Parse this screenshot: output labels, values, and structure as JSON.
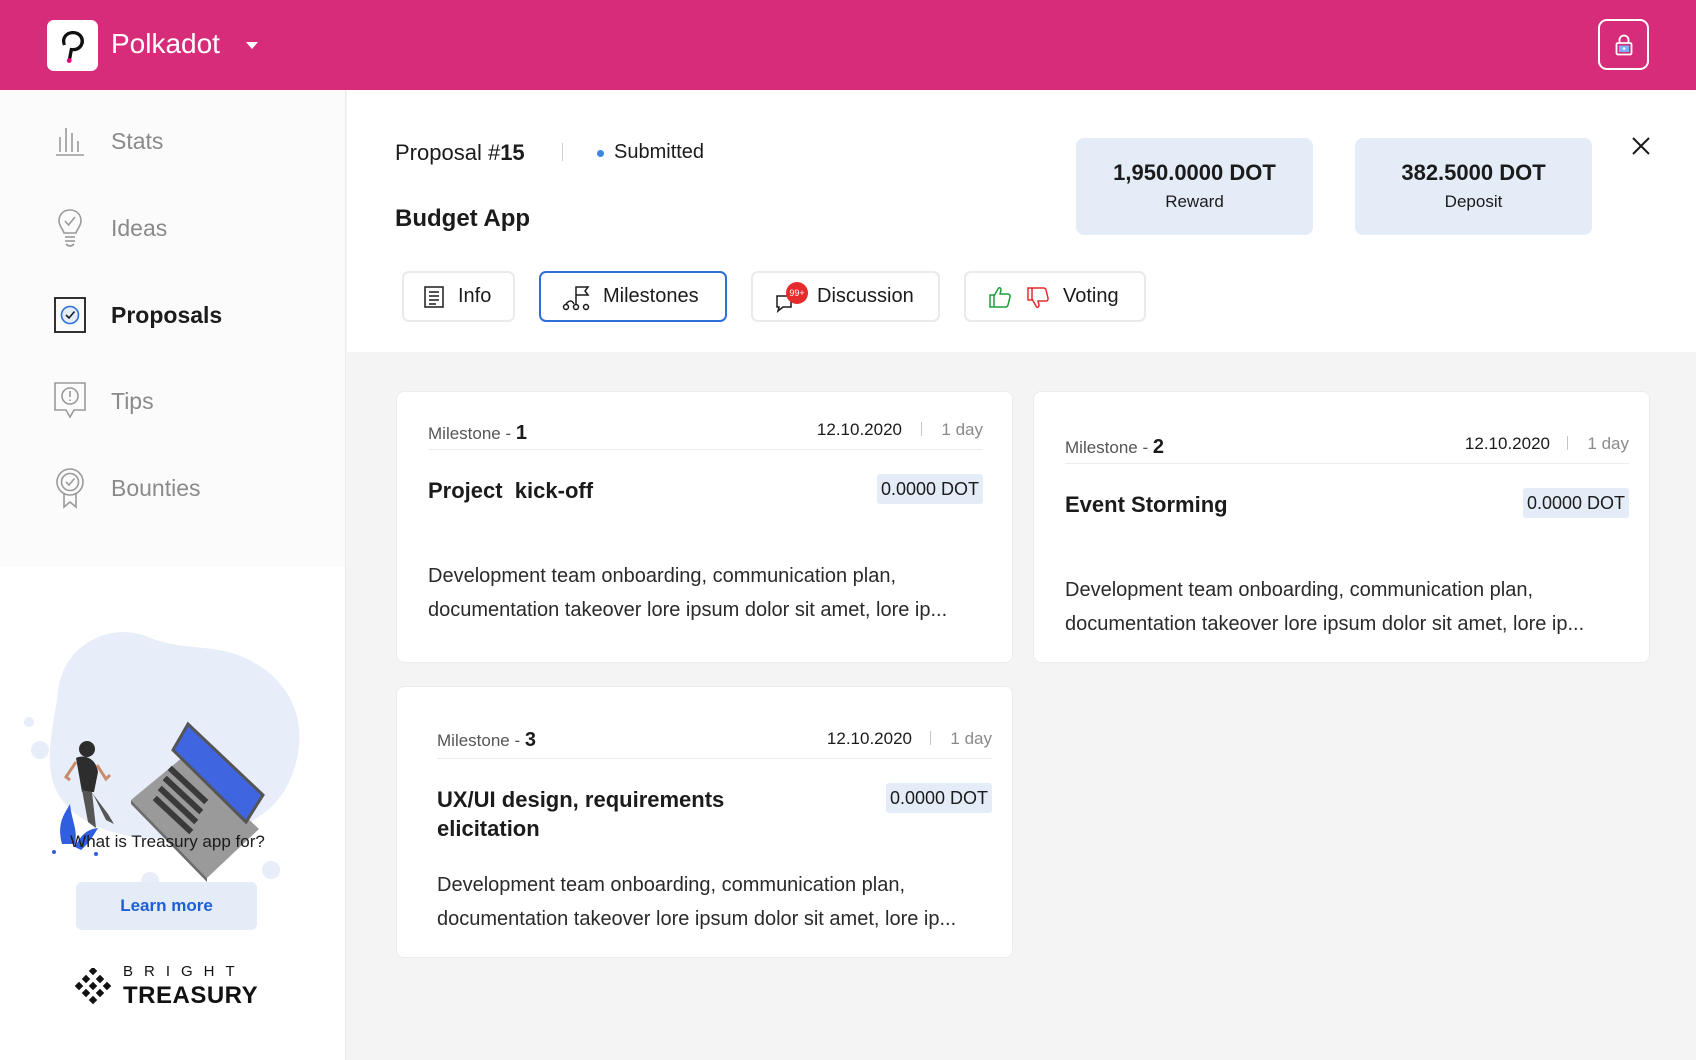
{
  "topbar": {
    "network": "Polkadot",
    "lock_icon": "lock-icon",
    "color": "#d62c79"
  },
  "sidebar": {
    "items": [
      {
        "label": "Stats",
        "icon": "bar-chart-icon",
        "active": false
      },
      {
        "label": "Ideas",
        "icon": "lightbulb-icon",
        "active": false
      },
      {
        "label": "Proposals",
        "icon": "checklist-icon",
        "active": true
      },
      {
        "label": "Tips",
        "icon": "exclamation-bubble-icon",
        "active": false
      },
      {
        "label": "Bounties",
        "icon": "badge-icon",
        "active": false
      }
    ],
    "promo_text": "What is Treasury app for?",
    "learn_more": "Learn more",
    "brand_top": "BRIGHT",
    "brand_bottom": "TREASURY"
  },
  "proposal": {
    "label": "Proposal #",
    "number": "15",
    "status": "Submitted",
    "name": "Budget App",
    "reward_value": "1,950.0000 DOT",
    "reward_label": "Reward",
    "deposit_value": "382.5000 DOT",
    "deposit_label": "Deposit"
  },
  "tabs": [
    {
      "label": "Info",
      "icon": "document-icon"
    },
    {
      "label": "Milestones",
      "icon": "flag-route-icon",
      "active": true
    },
    {
      "label": "Discussion",
      "icon": "chat-icon",
      "badge": "99+"
    },
    {
      "label": "Voting",
      "icon": "thumbs-icon"
    }
  ],
  "milestones": [
    {
      "prefix": "Milestone - ",
      "number": "1",
      "date": "12.10.2020",
      "duration": "1 day",
      "title": "Project  kick-off",
      "amount": "0.0000 DOT",
      "description": "Development team onboarding, communication plan, documentation takeover lore ipsum dolor sit amet, lore ip..."
    },
    {
      "prefix": "Milestone - ",
      "number": "2",
      "date": "12.10.2020",
      "duration": "1 day",
      "title": "Event Storming",
      "amount": "0.0000 DOT",
      "description": "Development team onboarding, communication plan, documentation takeover lore ipsum dolor sit amet, lore ip..."
    },
    {
      "prefix": "Milestone - ",
      "number": "3",
      "date": "12.10.2020",
      "duration": "1 day",
      "title": "UX/UI design, requirements elicitation",
      "amount": "0.0000 DOT",
      "description": "Development team onboarding, communication plan, documentation takeover lore ipsum dolor sit amet, lore ip..."
    }
  ]
}
